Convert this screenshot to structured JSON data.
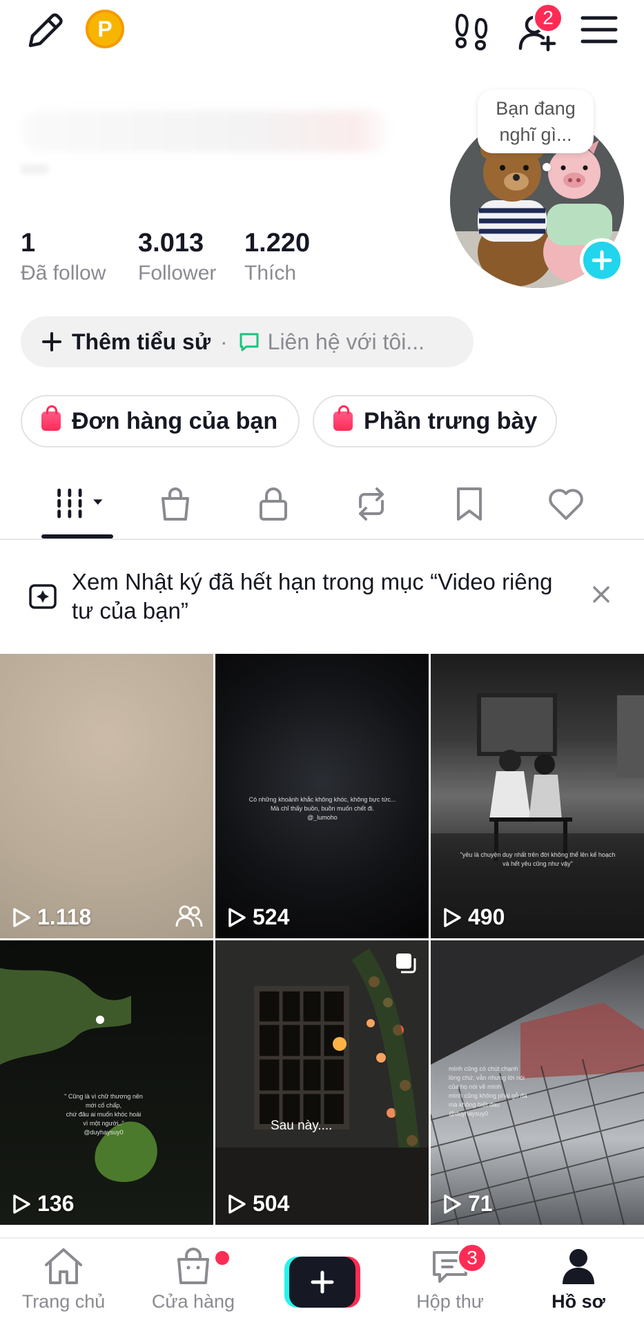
{
  "topbar": {
    "points_badge": "P",
    "notification_count": "2",
    "icons": [
      "pencil-icon",
      "points-icon",
      "footprints-icon",
      "add-friend-icon",
      "menu-icon"
    ]
  },
  "profile": {
    "thought_bubble": "Bạn đang nghĩ gì...",
    "stats": [
      {
        "value": "1",
        "label": "Đã follow"
      },
      {
        "value": "3.013",
        "label": "Follower"
      },
      {
        "value": "1.220",
        "label": "Thích"
      }
    ],
    "bio": {
      "add_bio": "Thêm tiểu sử",
      "separator": "·",
      "contact": "Liên hệ với tôi..."
    },
    "shop_buttons": [
      "Đơn hàng của bạn",
      "Phần trưng bày"
    ]
  },
  "tabs": [
    "videos-grid-icon",
    "shop-bag-icon",
    "lock-icon",
    "repost-icon",
    "bookmark-icon",
    "heart-icon"
  ],
  "banner": {
    "text": "Xem Nhật ký đã hết hạn trong mục “Video riêng tư của bạn”"
  },
  "videos": [
    {
      "views": "1.118",
      "friends_only": true
    },
    {
      "views": "524",
      "caption": "Có những khoảnh khắc không khóc, không bực tức...\nMà chỉ thấy buồn, buồn muốn chết đi.\n@_lumoho"
    },
    {
      "views": "490",
      "caption": "\"yêu là chuyện duy nhất trên đời không thể lên kế hoạch\nvà hết yêu cũng như vậy\""
    },
    {
      "views": "136",
      "caption": "\" Cũng là vì chữ thương nên\nmới cố chấp,\nchứ đâu ai muốn khóc hoài\nvì một người..\"\n@duyhaysuy0"
    },
    {
      "views": "504",
      "caption_large": "Sau này....",
      "multi_photo": true
    },
    {
      "views": "71",
      "caption": "mình cũng có chút chạnh\nlòng chứ, vẫn nhưng lời nói\ncủa họ nói về mình\nmình cũng không phải gỗ đá\nmà không biết đau\n@duyhaysuy0"
    }
  ],
  "bottom_nav": {
    "items": [
      {
        "label": "Trang chủ"
      },
      {
        "label": "Cửa hàng"
      },
      {
        "label": "Hộp thư"
      },
      {
        "label": "Hồ sơ"
      }
    ],
    "inbox_count": "3"
  },
  "colors": {
    "accent": "#fe2c55",
    "cyan": "#20d5ec",
    "text": "#161823",
    "muted": "#8a8b91"
  }
}
